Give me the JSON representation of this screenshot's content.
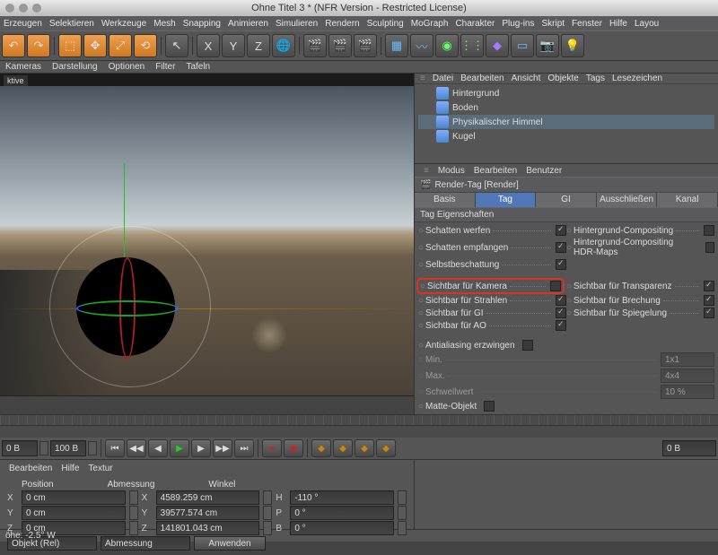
{
  "titlebar": "Ohne Titel 3 * (NFR Version - Restricted License)",
  "menubar": [
    "Erzeugen",
    "Selektieren",
    "Werkzeuge",
    "Mesh",
    "Snapping",
    "Animieren",
    "Simulieren",
    "Rendern",
    "Sculpting",
    "MoGraph",
    "Charakter",
    "Plug-ins",
    "Skript",
    "Fenster",
    "Hilfe",
    "Layou"
  ],
  "viewbar": [
    "Kameras",
    "Darstellung",
    "Optionen",
    "Filter",
    "Tafeln"
  ],
  "viewlabel": "ktive",
  "rp_menu": [
    "Datei",
    "Bearbeiten",
    "Ansicht",
    "Objekte",
    "Tags",
    "Lesezeichen"
  ],
  "objects": [
    {
      "name": "Hintergrund",
      "sel": false
    },
    {
      "name": "Boden",
      "sel": false
    },
    {
      "name": "Physikalischer Himmel",
      "sel": true
    },
    {
      "name": "Kugel",
      "sel": false
    }
  ],
  "attr_menu": [
    "Modus",
    "Bearbeiten",
    "Benutzer"
  ],
  "attr_title": "Render-Tag [Render]",
  "tabs": [
    "Basis",
    "Tag",
    "GI",
    "Ausschließen",
    "Kanal"
  ],
  "active_tab": 1,
  "section": "Tag Eigenschaften",
  "props_left": [
    {
      "label": "Schatten werfen",
      "on": true
    },
    {
      "label": "Schatten empfangen",
      "on": true
    },
    {
      "label": "Selbstbeschattung",
      "on": true
    }
  ],
  "props_right": [
    {
      "label": "Hintergrund-Compositing",
      "on": false
    },
    {
      "label": "Hintergrund-Compositing HDR-Maps",
      "on": false
    }
  ],
  "props_left2": [
    {
      "label": "Sichtbar für Kamera",
      "on": false,
      "hl": true
    },
    {
      "label": "Sichtbar für Strahlen",
      "on": true
    },
    {
      "label": "Sichtbar für GI",
      "on": true
    }
  ],
  "props_right2": [
    {
      "label": "Sichtbar für Transparenz",
      "on": true
    },
    {
      "label": "Sichtbar für Brechung",
      "on": true
    },
    {
      "label": "Sichtbar für Spiegelung",
      "on": true
    },
    {
      "label": "Sichtbar für AO",
      "on": true
    }
  ],
  "props_bottom": [
    {
      "label": "Antialiasing erzwingen",
      "on": false
    },
    {
      "label": "Min.",
      "val": "1x1",
      "dis": true
    },
    {
      "label": "Max.",
      "val": "4x4",
      "dis": true
    },
    {
      "label": "Schwellwert",
      "val": "10 %",
      "dis": true
    },
    {
      "label": "Matte-Objekt",
      "on": false
    }
  ],
  "time_start": "0 B",
  "time_end": "100 B",
  "time_frame": "0 B",
  "bot_tabs": [
    "Bearbeiten",
    "Hilfe",
    "Textur"
  ],
  "coord_headers": [
    "Position",
    "Abmessung",
    "Winkel"
  ],
  "coord": {
    "X": {
      "pos": "0 cm",
      "dim": "4589.259 cm",
      "ang": "-110 °"
    },
    "Y": {
      "pos": "0 cm",
      "dim": "39577.574 cm",
      "ang": "0 °"
    },
    "Z": {
      "pos": "0 cm",
      "dim": "141801.043 cm",
      "ang": "0 °"
    }
  },
  "coord_mode": "Objekt (Rel)",
  "coord_mode2": "Abmessung",
  "coord_apply": "Anwenden",
  "status": "öhe:  -2.5° W",
  "ang_labels": {
    "H": "H",
    "P": "P",
    "B": "B"
  }
}
